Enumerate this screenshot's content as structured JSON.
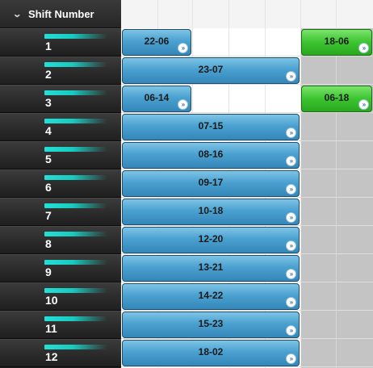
{
  "header": {
    "title": "Shift Number",
    "expand_icon": "chevron-down-icon"
  },
  "rows": [
    {
      "number": "1",
      "shifts": [
        {
          "label": "22-06",
          "color": "blue"
        },
        {
          "label": "18-06",
          "color": "green"
        }
      ]
    },
    {
      "number": "2",
      "shifts": [
        {
          "label": "23-07",
          "color": "blue"
        }
      ]
    },
    {
      "number": "3",
      "shifts": [
        {
          "label": "06-14",
          "color": "blue"
        },
        {
          "label": "06-18",
          "color": "green"
        }
      ]
    },
    {
      "number": "4",
      "shifts": [
        {
          "label": "07-15",
          "color": "blue"
        }
      ]
    },
    {
      "number": "5",
      "shifts": [
        {
          "label": "08-16",
          "color": "blue"
        }
      ]
    },
    {
      "number": "6",
      "shifts": [
        {
          "label": "09-17",
          "color": "blue"
        }
      ]
    },
    {
      "number": "7",
      "shifts": [
        {
          "label": "10-18",
          "color": "blue"
        }
      ]
    },
    {
      "number": "8",
      "shifts": [
        {
          "label": "12-20",
          "color": "blue"
        }
      ]
    },
    {
      "number": "9",
      "shifts": [
        {
          "label": "13-21",
          "color": "blue"
        }
      ]
    },
    {
      "number": "10",
      "shifts": [
        {
          "label": "14-22",
          "color": "blue"
        }
      ]
    },
    {
      "number": "11",
      "shifts": [
        {
          "label": "15-23",
          "color": "blue"
        }
      ]
    },
    {
      "number": "12",
      "shifts": [
        {
          "label": "18-02",
          "color": "blue"
        }
      ]
    }
  ],
  "more_button_glyph": "»",
  "colors": {
    "blue_shift": "#4aa1d0",
    "green_shift": "#3cc430",
    "accent_bar": "#22e1d7",
    "off_hours": "#c4c4c4"
  }
}
